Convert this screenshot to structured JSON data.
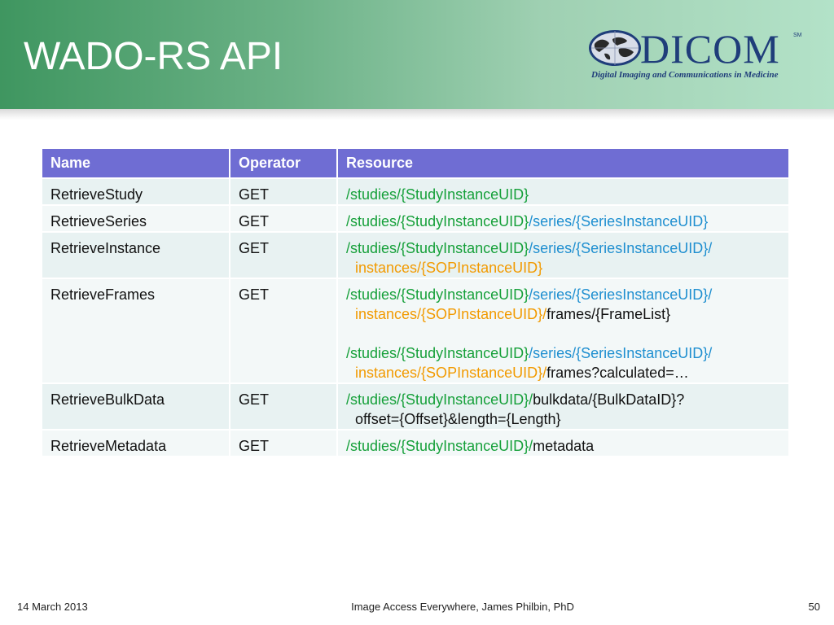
{
  "slide": {
    "title": "WADO-RS API"
  },
  "logo": {
    "wordmark": "DICOM",
    "sm": "SM",
    "tagline": "Digital Imaging and Communications in Medicine"
  },
  "colors": {
    "header_green": "#3f9660",
    "header_mint": "#b3e2c8",
    "table_header": "#6f6dd3",
    "uid_study": "#16a03a",
    "uid_series": "#1f8fd0",
    "uid_instance": "#f29a00",
    "logo_blue": "#1f3d7a"
  },
  "table": {
    "columns": [
      "Name",
      "Operator",
      "Resource"
    ],
    "rows": [
      {
        "name": "RetrieveStudy",
        "operator": "GET",
        "resource": [
          [
            {
              "text": "/studies/{StudyInstanceUID}",
              "color": "green"
            }
          ]
        ]
      },
      {
        "name": "RetrieveSeries",
        "operator": "GET",
        "resource": [
          [
            {
              "text": "/studies/{StudyInstanceUID}",
              "color": "green"
            },
            {
              "text": "/series/{SeriesInstanceUID}",
              "color": "blue"
            }
          ]
        ]
      },
      {
        "name": "RetrieveInstance",
        "operator": "GET",
        "resource": [
          [
            {
              "text": "/studies/{StudyInstanceUID}",
              "color": "green"
            },
            {
              "text": "/series/{SeriesInstanceUID}/",
              "color": "blue"
            }
          ],
          [
            {
              "text": "instances/{SOPInstanceUID}",
              "color": "orange"
            }
          ]
        ]
      },
      {
        "name": "RetrieveFrames",
        "operator": "GET",
        "resource": [
          [
            {
              "text": "/studies/{StudyInstanceUID}",
              "color": "green"
            },
            {
              "text": "/series/{SeriesInstanceUID}/",
              "color": "blue"
            }
          ],
          [
            {
              "text": "instances/{SOPInstanceUID}/",
              "color": "orange"
            },
            {
              "text": "frames/{FrameList}",
              "color": "black"
            }
          ],
          [],
          [
            {
              "text": "/studies/{StudyInstanceUID}",
              "color": "green"
            },
            {
              "text": "/series/{SeriesInstanceUID}/",
              "color": "blue"
            }
          ],
          [
            {
              "text": "instances/{SOPInstanceUID}/",
              "color": "orange"
            },
            {
              "text": "frames?calculated=…",
              "color": "black"
            }
          ]
        ]
      },
      {
        "name": "RetrieveBulkData",
        "operator": "GET",
        "resource": [
          [
            {
              "text": "/studies/{StudyInstanceUID}/",
              "color": "green"
            },
            {
              "text": "bulkdata/{BulkDataID}?",
              "color": "black"
            }
          ],
          [
            {
              "text": "offset={Offset}&length={Length}",
              "color": "black"
            }
          ]
        ]
      },
      {
        "name": "RetrieveMetadata",
        "operator": "GET",
        "resource": [
          [
            {
              "text": "/studies/{StudyInstanceUID}/",
              "color": "green"
            },
            {
              "text": "metadata",
              "color": "black"
            }
          ]
        ]
      }
    ]
  },
  "footer": {
    "date": "14 March 2013",
    "center": "Image Access Everywhere, James Philbin, PhD",
    "page": "50"
  }
}
